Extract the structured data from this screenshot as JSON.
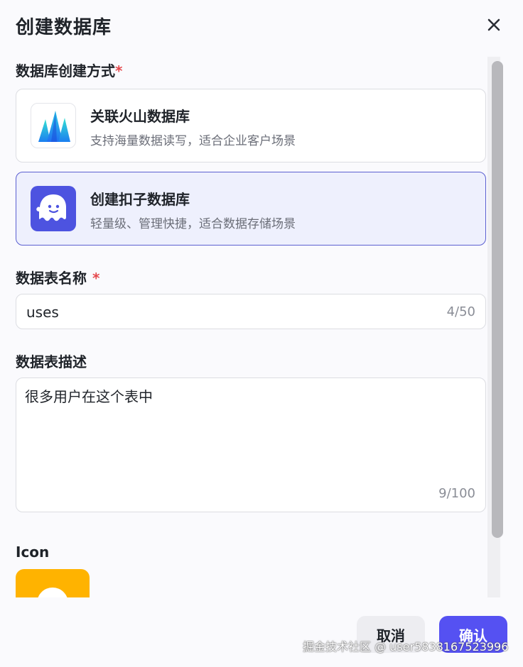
{
  "dialog": {
    "title": "创建数据库"
  },
  "creation_method": {
    "label": "数据库创建方式",
    "required_mark": "*",
    "options": [
      {
        "title": "关联火山数据库",
        "description": "支持海量数据读写，适合企业客户场景",
        "icon": "volcano-mountains-icon",
        "selected": false
      },
      {
        "title": "创建扣子数据库",
        "description": "轻量级、管理快捷，适合数据存储场景",
        "icon": "coze-ghost-icon",
        "selected": true
      }
    ]
  },
  "table_name": {
    "label": "数据表名称",
    "required_mark": "*",
    "value": "uses",
    "counter": "4/50"
  },
  "table_description": {
    "label": "数据表描述",
    "value": "很多用户在这个表中",
    "counter": "9/100"
  },
  "icon_section": {
    "label": "Icon",
    "preview_color": "#ffb300"
  },
  "footer": {
    "cancel_label": "取消",
    "confirm_label": "确认"
  },
  "watermark": "掘金技术社区 @ user5838167523996",
  "colors": {
    "accent": "#5551f2",
    "selected_bg": "#eef0fd",
    "required": "#e5484d"
  }
}
